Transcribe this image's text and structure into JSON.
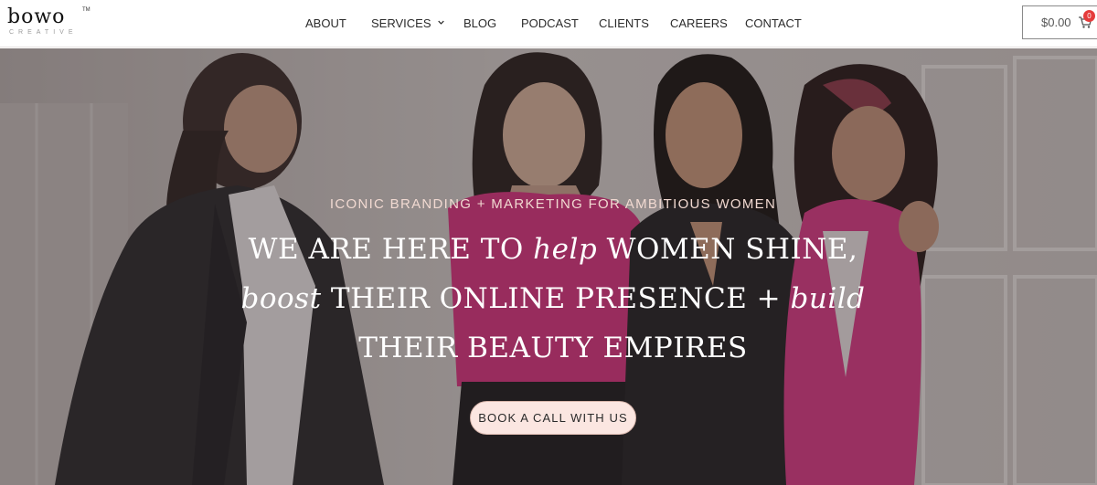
{
  "brand": {
    "logo_text": "bowo",
    "logo_subtext": "CREATIVE",
    "logo_tm": "TM"
  },
  "nav": {
    "items": [
      {
        "label": "ABOUT"
      },
      {
        "label": "SERVICES",
        "has_dropdown": true
      },
      {
        "label": "BLOG"
      },
      {
        "label": "PODCAST"
      },
      {
        "label": "CLIENTS"
      },
      {
        "label": "CAREERS"
      },
      {
        "label": "CONTACT"
      }
    ]
  },
  "cart": {
    "price": "$0.00",
    "count": "0",
    "icon": "cart-icon"
  },
  "hero": {
    "tagline": "ICONIC BRANDING + MARKETING FOR AMBITIOUS WOMEN",
    "line1": {
      "a": "WE ARE HERE TO ",
      "script": "help",
      "b": " WOMEN SHINE,"
    },
    "line2": {
      "script_a": "boost",
      "mid": " THEIR ONLINE PRESENCE + ",
      "script_b": "build"
    },
    "line3": "THEIR BEAUTY EMPIRES",
    "cta_label": "BOOK A CALL WITH US"
  },
  "colors": {
    "accent_pink": "#e23b8c",
    "tagline": "#f1d9d1",
    "cta_bg": "#fbe6e1",
    "badge": "#e53b3b"
  }
}
